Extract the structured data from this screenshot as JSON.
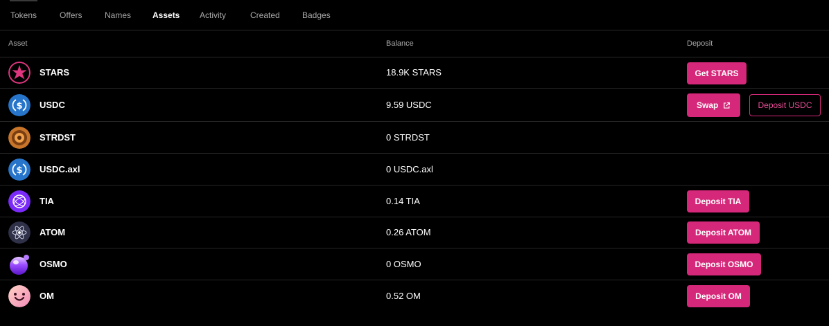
{
  "tabs": [
    {
      "label": "Tokens",
      "active": false
    },
    {
      "label": "Offers",
      "active": false
    },
    {
      "label": "Names",
      "active": false
    },
    {
      "label": "Assets",
      "active": true
    },
    {
      "label": "Activity",
      "active": false
    },
    {
      "label": "Created",
      "active": false
    },
    {
      "label": "Badges",
      "active": false
    }
  ],
  "table": {
    "headers": {
      "asset": "Asset",
      "balance": "Balance",
      "deposit": "Deposit"
    },
    "rows": [
      {
        "name": "STARS",
        "balance": "18.9K STARS",
        "icon": "stars-icon",
        "buttons": [
          {
            "label": "Get STARS",
            "style": "primary"
          }
        ]
      },
      {
        "name": "USDC",
        "balance": "9.59 USDC",
        "icon": "usdc-icon",
        "buttons": [
          {
            "label": "Swap",
            "style": "primary",
            "trailing_icon": "external-link-icon"
          },
          {
            "label": "Deposit USDC",
            "style": "outline"
          }
        ]
      },
      {
        "name": "STRDST",
        "balance": "0 STRDST",
        "icon": "strdst-icon",
        "buttons": []
      },
      {
        "name": "USDC.axl",
        "balance": "0 USDC.axl",
        "icon": "usdc-icon",
        "buttons": []
      },
      {
        "name": "TIA",
        "balance": "0.14 TIA",
        "icon": "tia-icon",
        "buttons": [
          {
            "label": "Deposit TIA",
            "style": "primary"
          }
        ]
      },
      {
        "name": "ATOM",
        "balance": "0.26 ATOM",
        "icon": "atom-icon",
        "buttons": [
          {
            "label": "Deposit ATOM",
            "style": "primary"
          }
        ]
      },
      {
        "name": "OSMO",
        "balance": "0 OSMO",
        "icon": "osmo-icon",
        "buttons": [
          {
            "label": "Deposit OSMO",
            "style": "primary"
          }
        ]
      },
      {
        "name": "OM",
        "balance": "0.52 OM",
        "icon": "om-icon",
        "buttons": [
          {
            "label": "Deposit OM",
            "style": "primary"
          }
        ]
      }
    ]
  },
  "colors": {
    "accent": "#d6287a",
    "background": "#000000",
    "muted_text": "#a9a9a9"
  }
}
